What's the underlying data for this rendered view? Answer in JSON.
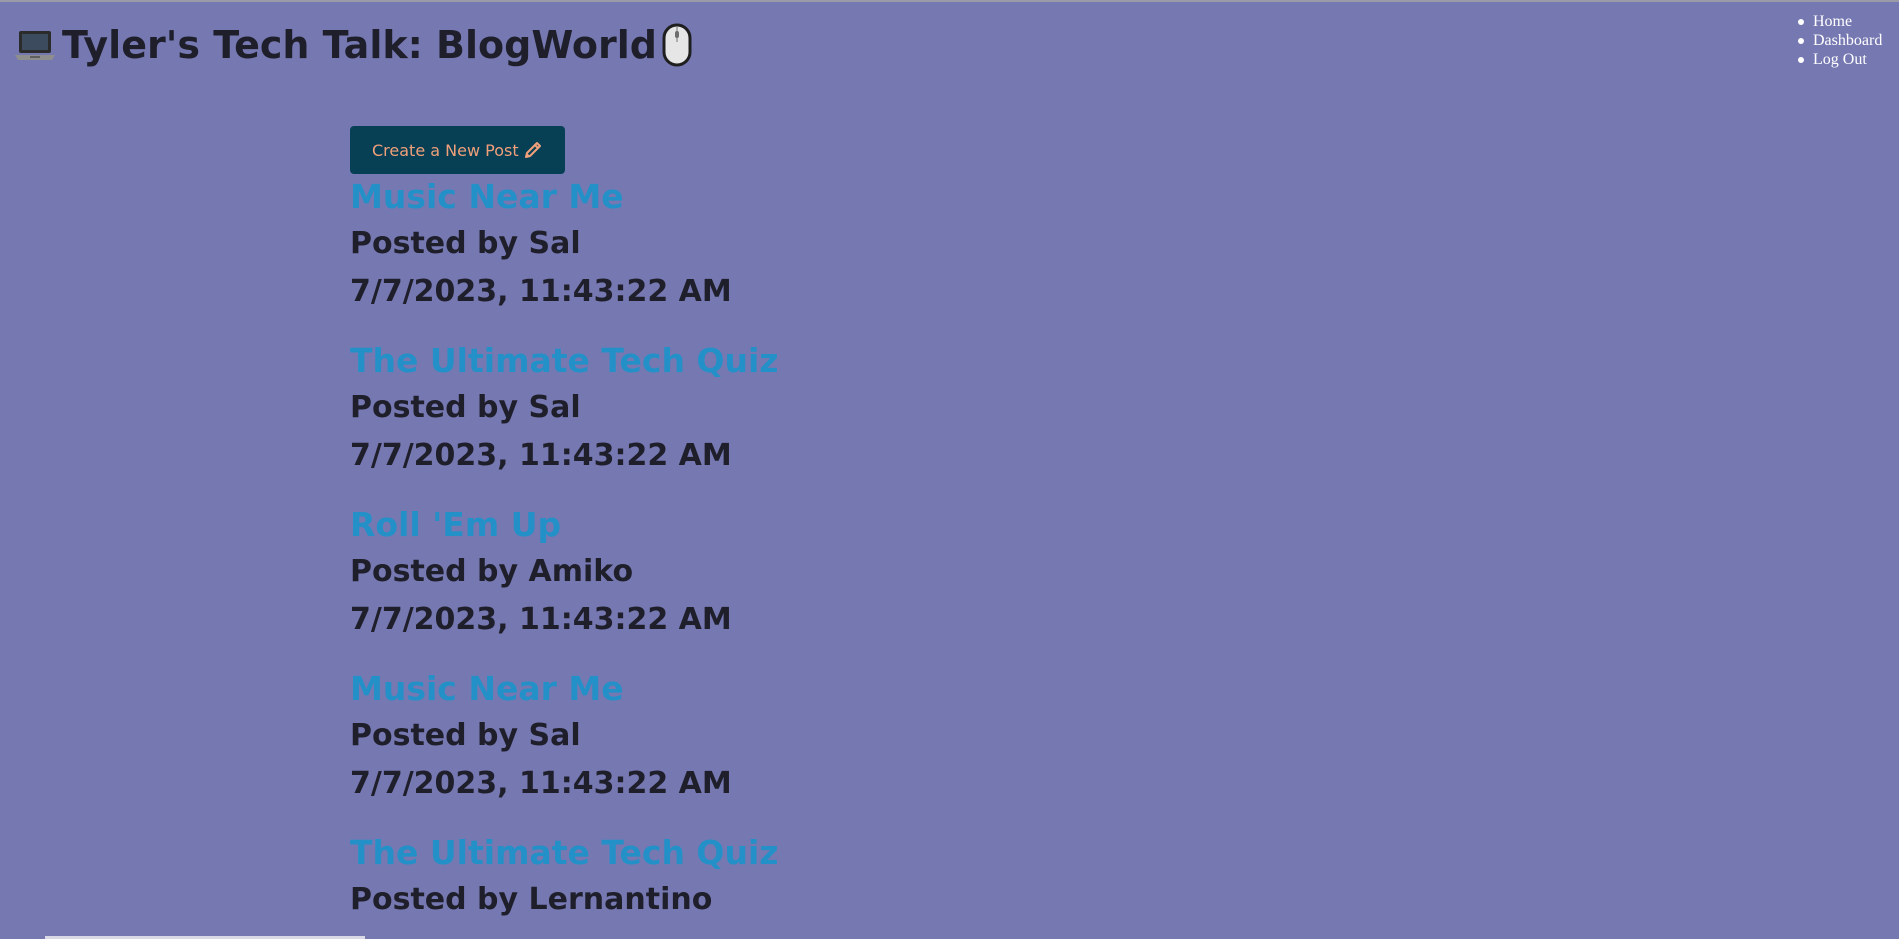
{
  "header": {
    "title": "Tyler's Tech Talk: BlogWorld",
    "left_icon": "laptop-icon",
    "right_icon": "mouse-icon"
  },
  "nav": {
    "items": [
      {
        "label": "Home"
      },
      {
        "label": "Dashboard"
      },
      {
        "label": "Log Out"
      }
    ]
  },
  "main": {
    "new_post_label": "Create a New Post",
    "new_post_icon": "pencil-icon",
    "posts": [
      {
        "title": "Music Near Me",
        "author": "Posted by Sal",
        "date": "7/7/2023, 11:43:22 AM"
      },
      {
        "title": "The Ultimate Tech Quiz",
        "author": "Posted by Sal",
        "date": "7/7/2023, 11:43:22 AM"
      },
      {
        "title": "Roll 'Em Up",
        "author": "Posted by Amiko",
        "date": "7/7/2023, 11:43:22 AM"
      },
      {
        "title": "Music Near Me",
        "author": "Posted by Sal",
        "date": "7/7/2023, 11:43:22 AM"
      },
      {
        "title": "The Ultimate Tech Quiz",
        "author": "Posted by Lernantino",
        "date": ""
      }
    ]
  },
  "colors": {
    "background": "#7678b2",
    "button_bg": "#073f55",
    "button_text": "#f0a07a",
    "post_title": "#2490c8",
    "text": "#1f1f2b"
  }
}
